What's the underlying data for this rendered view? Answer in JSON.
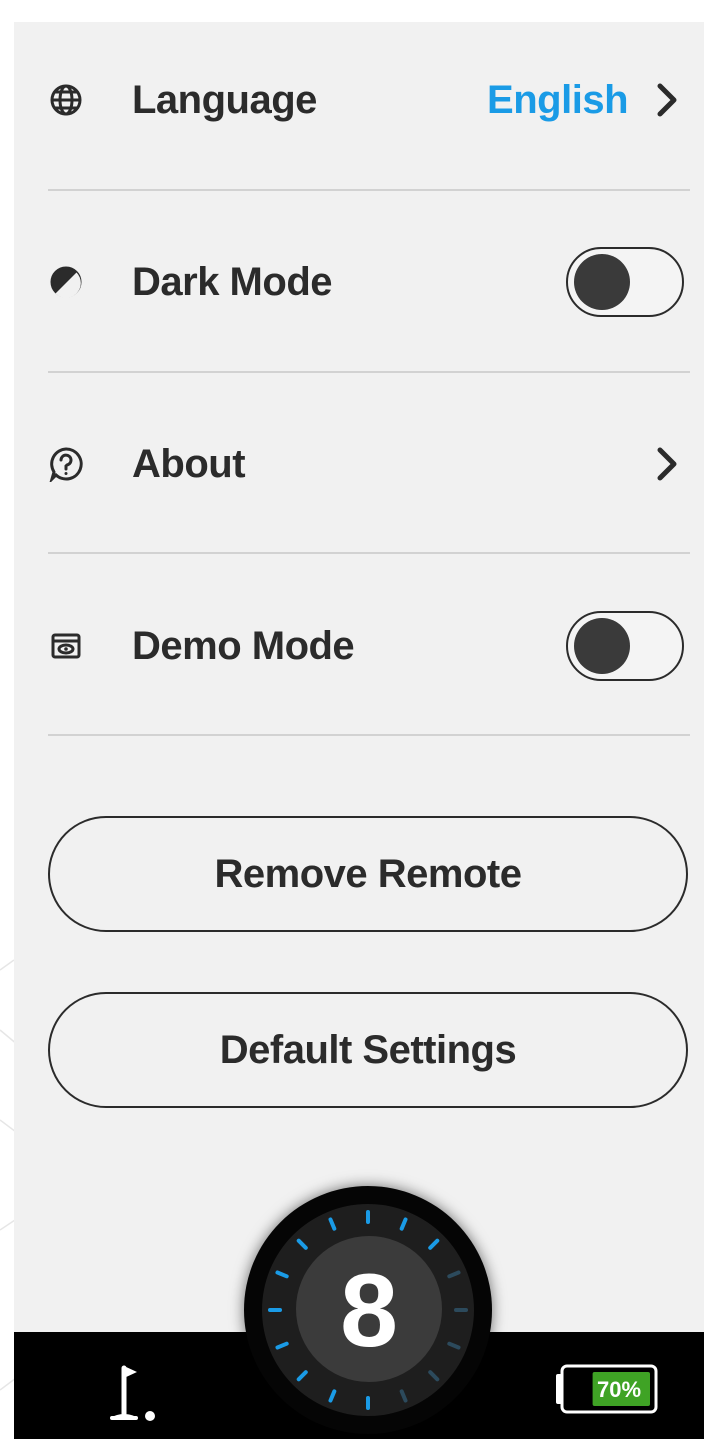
{
  "settings": {
    "language": {
      "label": "Language",
      "value": "English",
      "icon": "globe-icon"
    },
    "dark_mode": {
      "label": "Dark Mode",
      "enabled": false,
      "icon": "half-circle-icon"
    },
    "about": {
      "label": "About",
      "icon": "question-circle-icon"
    },
    "demo_mode": {
      "label": "Demo Mode",
      "enabled": false,
      "icon": "eye-display-icon"
    }
  },
  "buttons": {
    "remove_remote": "Remove Remote",
    "default_settings": "Default Settings"
  },
  "bottom_bar": {
    "dial_value": "8",
    "flag_icon": "golf-flag-icon",
    "battery_label": "70%",
    "battery_level": 0.7
  },
  "colors": {
    "accent": "#1a9be6",
    "text": "#2b2b2b",
    "battery_fill": "#3fa325",
    "panel": "#f1f1f1"
  }
}
